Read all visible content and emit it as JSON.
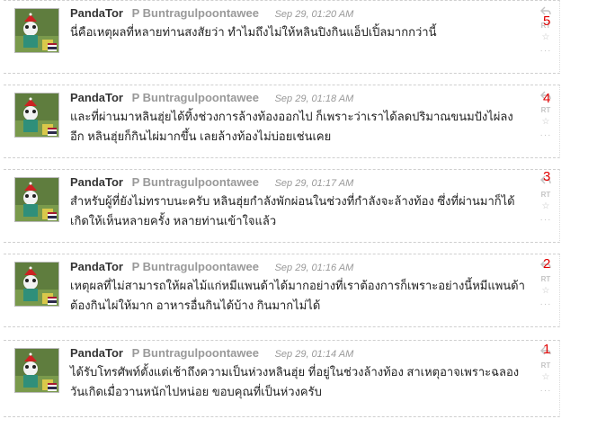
{
  "tweets": [
    {
      "annotation": "5",
      "screen_name": "PandaTor",
      "full_name": "P Buntragulpoontawee",
      "timestamp": "Sep 29, 01:20 AM",
      "text": "นี่คือเหตุผลที่หลายท่านสงสัยว่า ทำไมถึงไม่ให้หลินปิงกินแอ็ปเปิ้ลมากกว่านี้"
    },
    {
      "annotation": "4",
      "screen_name": "PandaTor",
      "full_name": "P Buntragulpoontawee",
      "timestamp": "Sep 29, 01:18 AM",
      "text": "และที่ผ่านมาหลินฮุ่ยได้ทิ้งช่วงการล้างท้องออกไป ก็เพราะว่าเราได้ลดปริมาณขนมปังไผ่ลงอีก หลินฮุ่ยก็กินไผ่มากขึ้น เลยล้างท้องไม่บ่อยเช่นเคย"
    },
    {
      "annotation": "3",
      "screen_name": "PandaTor",
      "full_name": "P Buntragulpoontawee",
      "timestamp": "Sep 29, 01:17 AM",
      "text": "สำหรับผู้ที่ยังไม่ทราบนะครับ หลินฮุ่ยกำลังพักผ่อนในช่วงที่กำลังจะล้างท้อง ซึ่งที่ผ่านมาก็ได้เกิดให้เห็นหลายครั้ง หลายท่านเข้าใจแล้ว"
    },
    {
      "annotation": "2",
      "screen_name": "PandaTor",
      "full_name": "P Buntragulpoontawee",
      "timestamp": "Sep 29, 01:16 AM",
      "text": "เหตุผลที่ไม่สามารถให้ผลไม้แก่หมีแพนด้าได้มากอย่างที่เราต้องการก็เพราะอย่างนี้หมีแพนด้าต้องกินไผ่ให้มาก อาหารอื่นกินได้บ้าง กินมากไม่ได้"
    },
    {
      "annotation": "1",
      "screen_name": "PandaTor",
      "full_name": "P Buntragulpoontawee",
      "timestamp": "Sep 29, 01:14 AM",
      "text": "ได้รับโทรศัพท์ตั้งแต่เช้าถึงความเป็นห่วงหลินฮุ่ย ที่อยู่ในช่วงล้างท้อง สาเหตุอาจเพราะฉลองวันเกิดเมื่อวานหนักไปหน่อย ขอบคุณที่เป็นห่วงครับ"
    }
  ],
  "actions": {
    "reply_icon": "reply-arrow-icon",
    "retweet_label": "RT",
    "favorite_icon": "star-icon",
    "more_label": "···"
  },
  "colors": {
    "annotation": "#e00000",
    "screen_name": "#333333",
    "meta": "#999999",
    "action": "#c4c4c4"
  }
}
